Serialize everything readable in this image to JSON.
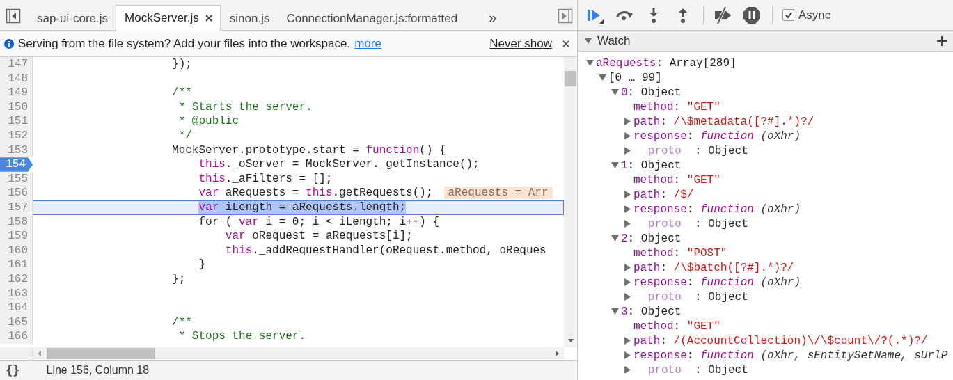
{
  "tabs": [
    {
      "label": "sap-ui-core.js",
      "selected": false
    },
    {
      "label": "MockServer.js",
      "selected": true
    },
    {
      "label": "sinon.js",
      "selected": false
    },
    {
      "label": "ConnectionManager.js:formatted",
      "selected": false
    }
  ],
  "more_tabs": "»",
  "infobar": {
    "message": "Serving from the file system? Add your files into the workspace.",
    "link": "more",
    "action": "Never show"
  },
  "code": {
    "lines": [
      {
        "number": "147",
        "breakpoint": false,
        "current": false,
        "tokens": [
          {
            "text": "                    });",
            "kind": "plain"
          }
        ]
      },
      {
        "number": "148",
        "breakpoint": false,
        "current": false
      },
      {
        "number": "149",
        "breakpoint": false,
        "current": false,
        "tokens": [
          {
            "text": "                    /**",
            "kind": "comment"
          }
        ]
      },
      {
        "number": "150",
        "breakpoint": false,
        "current": false,
        "tokens": [
          {
            "text": "                     * Starts the server.",
            "kind": "comment"
          }
        ]
      },
      {
        "number": "151",
        "breakpoint": false,
        "current": false,
        "tokens": [
          {
            "text": "                     * @public",
            "kind": "comment"
          }
        ]
      },
      {
        "number": "152",
        "breakpoint": false,
        "current": false,
        "tokens": [
          {
            "text": "                     */",
            "kind": "comment"
          }
        ]
      },
      {
        "number": "153",
        "breakpoint": false,
        "current": false,
        "tokens": [
          {
            "text": "                    MockServer.prototype.start = ",
            "kind": "plain"
          },
          {
            "text": "function",
            "kind": "keyword"
          },
          {
            "text": "() {",
            "kind": "plain"
          }
        ]
      },
      {
        "number": "154",
        "breakpoint": true,
        "current": false,
        "tokens": [
          {
            "text": "                        this",
            "kind": "keyword"
          },
          {
            "text": "._oServer = MockServer._getInstance();",
            "kind": "plain"
          }
        ]
      },
      {
        "number": "155",
        "breakpoint": false,
        "current": false,
        "tokens": [
          {
            "text": "                        this",
            "kind": "keyword"
          },
          {
            "text": "._aFilters = [];",
            "kind": "plain"
          }
        ]
      },
      {
        "number": "156",
        "breakpoint": false,
        "current": false,
        "tokens": [
          {
            "text": "                        var",
            "kind": "keyword"
          },
          {
            "text": " aRequests = ",
            "kind": "plain"
          },
          {
            "text": "this",
            "kind": "keyword"
          },
          {
            "text": ".getRequests();",
            "kind": "plain"
          }
        ],
        "inline_value": "aRequests = Arr"
      },
      {
        "number": "157",
        "breakpoint": false,
        "current": true,
        "tokens": [
          {
            "text": "                        var",
            "kind": "keyword"
          },
          {
            "text": " iLength = aRequests.length;",
            "kind": "plain"
          }
        ]
      },
      {
        "number": "158",
        "breakpoint": false,
        "current": false,
        "tokens": [
          {
            "text": "                        for ( ",
            "kind": "plain"
          },
          {
            "text": "var",
            "kind": "keyword"
          },
          {
            "text": " i = 0; i < iLength; i++) {",
            "kind": "plain"
          }
        ]
      },
      {
        "number": "159",
        "breakpoint": false,
        "current": false,
        "tokens": [
          {
            "text": "                            var",
            "kind": "keyword"
          },
          {
            "text": " oRequest = aRequests[i];",
            "kind": "plain"
          }
        ]
      },
      {
        "number": "160",
        "breakpoint": false,
        "current": false,
        "tokens": [
          {
            "text": "                            this",
            "kind": "keyword"
          },
          {
            "text": "._addRequestHandler(oRequest.method, oReques",
            "kind": "plain"
          }
        ]
      },
      {
        "number": "161",
        "breakpoint": false,
        "current": false,
        "tokens": [
          {
            "text": "                        }",
            "kind": "plain"
          }
        ]
      },
      {
        "number": "162",
        "breakpoint": false,
        "current": false,
        "tokens": [
          {
            "text": "                    };",
            "kind": "plain"
          }
        ]
      },
      {
        "number": "163",
        "breakpoint": false,
        "current": false
      },
      {
        "number": "164",
        "breakpoint": false,
        "current": false
      },
      {
        "number": "165",
        "breakpoint": false,
        "current": false,
        "tokens": [
          {
            "text": "                    /**",
            "kind": "comment"
          }
        ]
      },
      {
        "number": "166",
        "breakpoint": false,
        "current": false,
        "tokens": [
          {
            "text": "                     * Stops the server.",
            "kind": "comment"
          }
        ]
      }
    ]
  },
  "status_bar": {
    "pretty_print": "{}",
    "position": "Line 156, Column 18"
  },
  "debugger": {
    "async": {
      "label": "Async",
      "checked": true
    }
  },
  "watch": {
    "title": "Watch",
    "expanded": true,
    "items": [
      {
        "kind": "node",
        "expanded": true,
        "tokens": [
          {
            "text": "aRequests",
            "kind": "name"
          },
          {
            "text": ": Array[289]",
            "kind": "plain"
          }
        ],
        "children": [
          {
            "kind": "node",
            "expanded": true,
            "tokens": [
              {
                "text": "[0 … 99]",
                "kind": "plain"
              }
            ],
            "children": [
              {
                "kind": "node",
                "expanded": true,
                "tokens": [
                  {
                    "text": "0",
                    "kind": "name"
                  },
                  {
                    "text": ": Object",
                    "kind": "plain"
                  }
                ],
                "children": [
                  {
                    "kind": "leaf",
                    "tokens": [
                      {
                        "text": "method",
                        "kind": "name"
                      },
                      {
                        "text": ": ",
                        "kind": "plain"
                      },
                      {
                        "text": "\"GET\"",
                        "kind": "string"
                      }
                    ]
                  },
                  {
                    "kind": "node",
                    "expanded": false,
                    "tokens": [
                      {
                        "text": "path",
                        "kind": "name"
                      },
                      {
                        "text": ": ",
                        "kind": "plain"
                      },
                      {
                        "text": "/\\$metadata([?#].*)?/",
                        "kind": "string"
                      }
                    ]
                  },
                  {
                    "kind": "node",
                    "expanded": false,
                    "tokens": [
                      {
                        "text": "response",
                        "kind": "name"
                      },
                      {
                        "text": ": ",
                        "kind": "plain"
                      },
                      {
                        "text": "function",
                        "kind": "func"
                      },
                      {
                        "text": " (oXhr)",
                        "kind": "params"
                      }
                    ]
                  },
                  {
                    "kind": "node",
                    "expanded": false,
                    "tokens": [
                      {
                        "text": "proto",
                        "kind": "internal"
                      },
                      {
                        "text": ": Object",
                        "kind": "plain"
                      }
                    ]
                  }
                ]
              },
              {
                "kind": "node",
                "expanded": true,
                "tokens": [
                  {
                    "text": "1",
                    "kind": "name"
                  },
                  {
                    "text": ": Object",
                    "kind": "plain"
                  }
                ],
                "children": [
                  {
                    "kind": "leaf",
                    "tokens": [
                      {
                        "text": "method",
                        "kind": "name"
                      },
                      {
                        "text": ": ",
                        "kind": "plain"
                      },
                      {
                        "text": "\"GET\"",
                        "kind": "string"
                      }
                    ]
                  },
                  {
                    "kind": "node",
                    "expanded": false,
                    "tokens": [
                      {
                        "text": "path",
                        "kind": "name"
                      },
                      {
                        "text": ": ",
                        "kind": "plain"
                      },
                      {
                        "text": "/$/",
                        "kind": "string"
                      }
                    ]
                  },
                  {
                    "kind": "node",
                    "expanded": false,
                    "tokens": [
                      {
                        "text": "response",
                        "kind": "name"
                      },
                      {
                        "text": ": ",
                        "kind": "plain"
                      },
                      {
                        "text": "function",
                        "kind": "func"
                      },
                      {
                        "text": " (oXhr)",
                        "kind": "params"
                      }
                    ]
                  },
                  {
                    "kind": "node",
                    "expanded": false,
                    "tokens": [
                      {
                        "text": "proto",
                        "kind": "internal"
                      },
                      {
                        "text": ": Object",
                        "kind": "plain"
                      }
                    ]
                  }
                ]
              },
              {
                "kind": "node",
                "expanded": true,
                "tokens": [
                  {
                    "text": "2",
                    "kind": "name"
                  },
                  {
                    "text": ": Object",
                    "kind": "plain"
                  }
                ],
                "children": [
                  {
                    "kind": "leaf",
                    "tokens": [
                      {
                        "text": "method",
                        "kind": "name"
                      },
                      {
                        "text": ": ",
                        "kind": "plain"
                      },
                      {
                        "text": "\"POST\"",
                        "kind": "string"
                      }
                    ]
                  },
                  {
                    "kind": "node",
                    "expanded": false,
                    "tokens": [
                      {
                        "text": "path",
                        "kind": "name"
                      },
                      {
                        "text": ": ",
                        "kind": "plain"
                      },
                      {
                        "text": "/\\$batch([?#].*)?/",
                        "kind": "string"
                      }
                    ]
                  },
                  {
                    "kind": "node",
                    "expanded": false,
                    "tokens": [
                      {
                        "text": "response",
                        "kind": "name"
                      },
                      {
                        "text": ": ",
                        "kind": "plain"
                      },
                      {
                        "text": "function",
                        "kind": "func"
                      },
                      {
                        "text": " (oXhr)",
                        "kind": "params"
                      }
                    ]
                  },
                  {
                    "kind": "node",
                    "expanded": false,
                    "tokens": [
                      {
                        "text": "proto",
                        "kind": "internal"
                      },
                      {
                        "text": ": Object",
                        "kind": "plain"
                      }
                    ]
                  }
                ]
              },
              {
                "kind": "node",
                "expanded": true,
                "tokens": [
                  {
                    "text": "3",
                    "kind": "name"
                  },
                  {
                    "text": ": Object",
                    "kind": "plain"
                  }
                ],
                "children": [
                  {
                    "kind": "leaf",
                    "tokens": [
                      {
                        "text": "method",
                        "kind": "name"
                      },
                      {
                        "text": ": ",
                        "kind": "plain"
                      },
                      {
                        "text": "\"GET\"",
                        "kind": "string"
                      }
                    ]
                  },
                  {
                    "kind": "node",
                    "expanded": false,
                    "tokens": [
                      {
                        "text": "path",
                        "kind": "name"
                      },
                      {
                        "text": ": ",
                        "kind": "plain"
                      },
                      {
                        "text": "/(AccountCollection)\\/\\$count\\/?(.*)?/",
                        "kind": "string"
                      }
                    ]
                  },
                  {
                    "kind": "node",
                    "expanded": false,
                    "tokens": [
                      {
                        "text": "response",
                        "kind": "name"
                      },
                      {
                        "text": ": ",
                        "kind": "plain"
                      },
                      {
                        "text": "function",
                        "kind": "func"
                      },
                      {
                        "text": " (oXhr, sEntitySetName, sUrlP",
                        "kind": "params"
                      }
                    ]
                  },
                  {
                    "kind": "node",
                    "expanded": false,
                    "tokens": [
                      {
                        "text": "proto",
                        "kind": "internal"
                      },
                      {
                        "text": ": Object",
                        "kind": "plain"
                      }
                    ]
                  }
                ]
              }
            ]
          }
        ]
      }
    ]
  }
}
